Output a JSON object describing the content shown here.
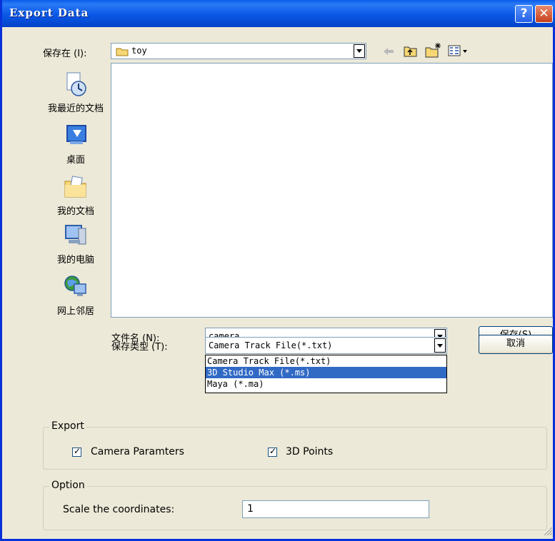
{
  "window": {
    "title": "Export Data",
    "help_label": "?",
    "close_label": "✕"
  },
  "toolbar": {
    "save_in_label": "保存在 (I):",
    "save_in_value": "toy",
    "back_icon": "back-arrow-icon",
    "up_icon": "up-folder-icon",
    "new_folder_icon": "new-folder-icon",
    "view_menu_icon": "view-menu-icon"
  },
  "places": [
    {
      "label": "我最近的文档",
      "icon": "recent-documents-icon"
    },
    {
      "label": "桌面",
      "icon": "desktop-icon"
    },
    {
      "label": "我的文档",
      "icon": "my-documents-icon"
    },
    {
      "label": "我的电脑",
      "icon": "my-computer-icon"
    },
    {
      "label": "网上邻居",
      "icon": "network-places-icon"
    }
  ],
  "file_name": {
    "label": "文件名 (N):",
    "value": "camera"
  },
  "file_type": {
    "label": "保存类型 (T):",
    "value": "Camera Track File(*.txt)",
    "options": [
      "Camera Track File(*.txt)",
      "3D Studio Max (*.ms)",
      "Maya (*.ma)"
    ],
    "highlighted": "3D Studio Max (*.ms)"
  },
  "buttons": {
    "save": "保存(S)",
    "cancel": "取消"
  },
  "export_group": {
    "title": "Export",
    "camera_params_label": "Camera Paramters",
    "camera_params_checked": true,
    "points_label": "3D Points",
    "points_checked": true
  },
  "option_group": {
    "title": "Option",
    "scale_label": "Scale the coordinates:",
    "scale_value": "1"
  },
  "colors": {
    "title_bar": "#0a58e6",
    "selection": "#316ac5",
    "dialog_bg": "#ece9d8"
  }
}
